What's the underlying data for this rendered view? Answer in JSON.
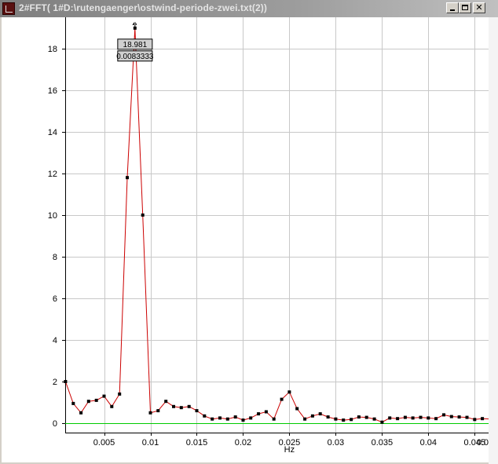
{
  "window": {
    "title": "2#FFT( 1#D:\\rutengaenger\\ostwind-periode-zwei.txt(2))",
    "app_icon": "fft-app-icon",
    "controls": {
      "minimize": "minimize-icon",
      "maximize": "maximize-icon",
      "close": "close-icon",
      "close_glyph": "✕"
    }
  },
  "chart_data": {
    "type": "line",
    "xlabel": "Hz",
    "ylabel": "",
    "title": "",
    "xlim": [
      0.0008,
      0.0465
    ],
    "ylim": [
      -0.3,
      19.2
    ],
    "x_ticks": [
      0.005,
      0.01,
      0.015,
      0.02,
      0.025,
      0.03,
      0.035,
      0.04,
      0.045,
      0.05
    ],
    "x_tick_labels": [
      "0.005",
      "0.01",
      "0.015",
      "0.02",
      "0.025",
      "0.03",
      "0.035",
      "0.04",
      "0.045",
      "0.0"
    ],
    "y_ticks": [
      0,
      2,
      4,
      6,
      8,
      10,
      12,
      14,
      16,
      18
    ],
    "y_tick_labels": [
      "0",
      "2",
      "4",
      "6",
      "8",
      "10",
      "12",
      "14",
      "16",
      "18"
    ],
    "grid": true,
    "colors": {
      "line": "#cc0000",
      "marker": "#000000",
      "baseline": "#00cc00",
      "grid": "#c8c8c8"
    },
    "series": [
      {
        "x": [
          0.00083,
          0.00167,
          0.0025,
          0.00333,
          0.00417,
          0.005,
          0.00583,
          0.00667,
          0.0075,
          0.00833,
          0.00917,
          0.01,
          0.01083,
          0.01167,
          0.0125,
          0.01333,
          0.01417,
          0.015,
          0.01583,
          0.01667,
          0.0175,
          0.01833,
          0.01917,
          0.02,
          0.02083,
          0.02167,
          0.0225,
          0.02333,
          0.02417,
          0.025,
          0.02583,
          0.02667,
          0.0275,
          0.02833,
          0.02917,
          0.03,
          0.03083,
          0.03167,
          0.0325,
          0.03333,
          0.03417,
          0.035,
          0.03583,
          0.03667,
          0.0375,
          0.03833,
          0.03917,
          0.04,
          0.04083,
          0.04167,
          0.0425,
          0.04333,
          0.04417,
          0.045,
          0.04583,
          0.04667
        ],
        "y": [
          2.0,
          0.95,
          0.5,
          1.05,
          1.1,
          1.3,
          0.8,
          1.4,
          11.8,
          18.981,
          10.0,
          0.5,
          0.6,
          1.05,
          0.8,
          0.75,
          0.8,
          0.6,
          0.35,
          0.2,
          0.25,
          0.2,
          0.3,
          0.15,
          0.25,
          0.45,
          0.55,
          0.2,
          1.15,
          1.5,
          0.7,
          0.2,
          0.35,
          0.45,
          0.3,
          0.2,
          0.15,
          0.18,
          0.3,
          0.28,
          0.2,
          0.05,
          0.25,
          0.22,
          0.28,
          0.25,
          0.28,
          0.25,
          0.22,
          0.4,
          0.32,
          0.3,
          0.28,
          0.18,
          0.22,
          0.2
        ]
      }
    ],
    "baseline_y": 0.0,
    "marker": {
      "x": 0.0083333,
      "y": 18.981,
      "value_label": "18.981",
      "freq_label": "0.0083333"
    }
  }
}
